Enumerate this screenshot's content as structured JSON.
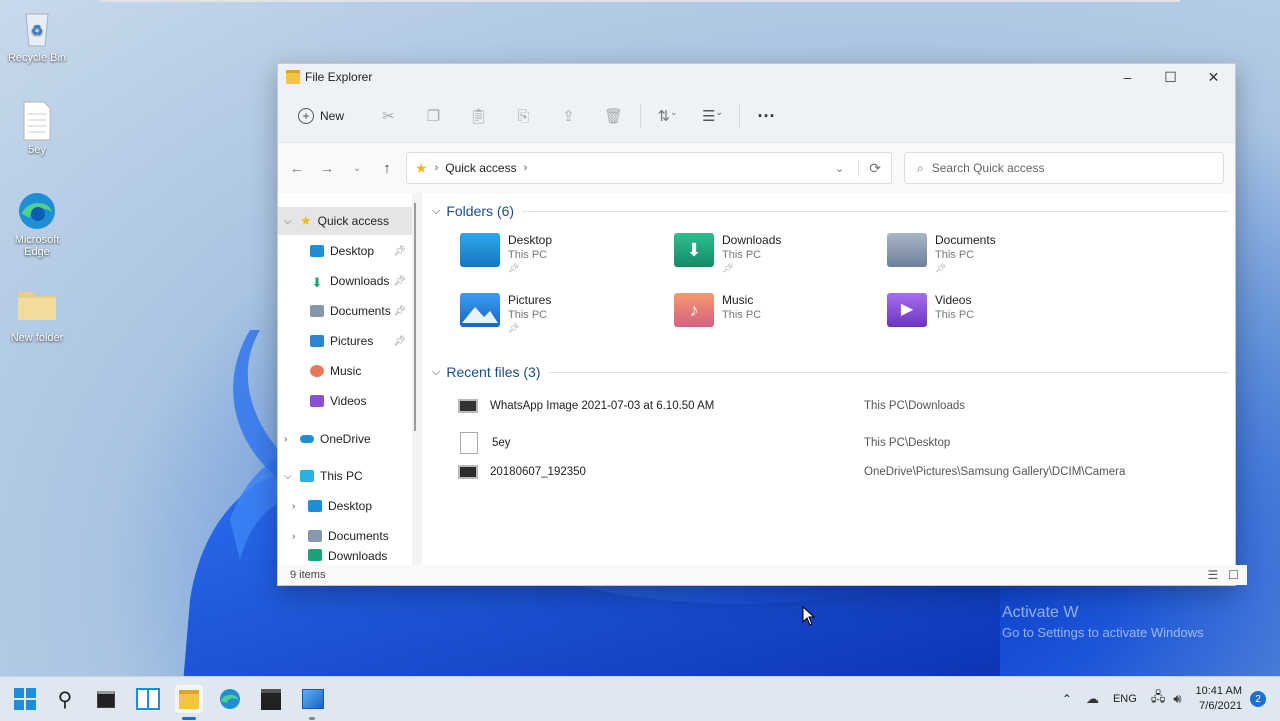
{
  "desktop": {
    "icons": [
      {
        "label": "Recycle Bin"
      },
      {
        "label": "5ey"
      },
      {
        "label": "Microsoft Edge"
      },
      {
        "label": "New folder"
      }
    ],
    "watermark": {
      "line1": "Activate W",
      "line2": "Go to Settings to activate Windows"
    }
  },
  "window": {
    "title": "File Explorer",
    "toolbar": {
      "new_label": "New"
    },
    "address": {
      "crumb": "Quick access"
    },
    "search": {
      "placeholder": "Search Quick access"
    },
    "nav": [
      {
        "label": "Quick access"
      },
      {
        "label": "Desktop"
      },
      {
        "label": "Downloads"
      },
      {
        "label": "Documents"
      },
      {
        "label": "Pictures"
      },
      {
        "label": "Music"
      },
      {
        "label": "Videos"
      },
      {
        "label": "OneDrive"
      },
      {
        "label": "This PC"
      },
      {
        "label": "Desktop"
      },
      {
        "label": "Documents"
      },
      {
        "label": "Downloads"
      }
    ],
    "folders_header": "Folders (6)",
    "folders": [
      {
        "name": "Desktop",
        "location": "This PC",
        "color": "#1e8fd6"
      },
      {
        "name": "Downloads",
        "location": "This PC",
        "color": "#1aa37a"
      },
      {
        "name": "Documents",
        "location": "This PC",
        "color": "#8797ae"
      },
      {
        "name": "Pictures",
        "location": "This PC",
        "color": "#2a86d8"
      },
      {
        "name": "Music",
        "location": "This PC",
        "color": "#e8785a"
      },
      {
        "name": "Videos",
        "location": "This PC",
        "color": "#8a4fd6"
      }
    ],
    "recent_header": "Recent files (3)",
    "recent": [
      {
        "name": "WhatsApp Image 2021-07-03 at 6.10.50 AM",
        "location": "This PC\\Downloads"
      },
      {
        "name": "5ey",
        "location": "This PC\\Desktop"
      },
      {
        "name": "20180607_192350",
        "location": "OneDrive\\Pictures\\Samsung Gallery\\DCIM\\Camera"
      }
    ],
    "status": "9 items"
  },
  "taskbar": {
    "lang": "ENG",
    "time": "10:41 AM",
    "date": "7/6/2021",
    "notifications": "2"
  }
}
